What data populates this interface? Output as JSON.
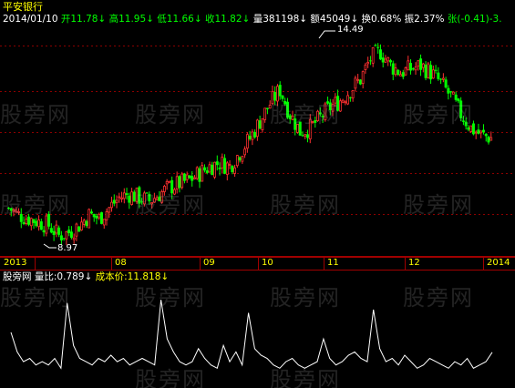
{
  "stock": {
    "name": "平安银行"
  },
  "header": {
    "date": "2014/01/10",
    "open_label": "开",
    "open": "11.78↓",
    "high_label": "高",
    "high": "11.95↓",
    "low_label": "低",
    "low": "11.66↓",
    "close_label": "收",
    "close": "11.82↓",
    "volume_label": "量",
    "volume": "381198↓",
    "amount_label": "额",
    "amount": "45049↓",
    "turnover_label": "换",
    "turnover": "0.68%",
    "amplitude_label": "振",
    "amplitude": "2.37%",
    "change_label": "张",
    "change": "(-0.41)-3."
  },
  "annotations": {
    "max_price": "14.49",
    "min_price": "8.97"
  },
  "x_axis": {
    "labels": [
      "2013",
      "08",
      "09",
      "10",
      "11",
      "12",
      "2014"
    ]
  },
  "indicator": {
    "name": "股旁网",
    "ratio_label": "量比:",
    "ratio_value": "0.789↓",
    "cost_label": "成本价:",
    "cost_value": "11.818↓"
  },
  "watermark": {
    "text": "股旁网"
  },
  "colors": {
    "up": "#ff3030",
    "down": "#00ff00",
    "grid": "#8b0000",
    "text": "#ffff00",
    "background": "#000000"
  },
  "chart_data": [
    {
      "type": "candlestick",
      "title": "平安银行",
      "x": [
        "2013",
        "08",
        "09",
        "10",
        "11",
        "12",
        "2014"
      ],
      "ylim": [
        8.5,
        15.0
      ],
      "series": [
        {
          "values": [
            9.8,
            9.6,
            9.5,
            9.4,
            9.3,
            9.0,
            9.1,
            9.3,
            9.6,
            9.5,
            9.8,
            10.1,
            10.2,
            10.1,
            10.0,
            10.2,
            10.4,
            10.5,
            10.6,
            10.8,
            11.0,
            11.1,
            11.0,
            11.4,
            11.8,
            12.3,
            12.8,
            13.2,
            12.5,
            12.0,
            12.1,
            12.4,
            12.7,
            12.9,
            13.2,
            13.5,
            14.1,
            14.3,
            13.9,
            13.7,
            13.8,
            13.9,
            13.7,
            13.4,
            13.0,
            12.5,
            12.1,
            11.9,
            11.82
          ]
        }
      ],
      "extremes": {
        "max": 14.49,
        "min": 8.97
      }
    },
    {
      "type": "line",
      "title": "股旁网",
      "series": [
        {
          "name": "量比",
          "values": [
            1.4,
            0.8,
            0.5,
            0.6,
            0.4,
            0.5,
            0.4,
            0.6,
            0.3,
            2.3,
            1.0,
            0.6,
            0.5,
            0.4,
            0.6,
            0.5,
            0.7,
            0.5,
            0.6,
            0.4,
            0.5,
            0.6,
            0.5,
            0.4,
            2.4,
            1.2,
            0.8,
            0.5,
            0.4,
            0.5,
            0.9,
            0.6,
            0.4,
            0.3,
            1.0,
            0.5,
            0.8,
            0.4,
            2.0,
            0.9,
            0.7,
            0.6,
            0.4,
            0.3,
            0.5,
            0.6,
            0.4,
            0.3,
            0.4,
            0.5,
            1.2,
            0.6,
            0.4,
            0.5,
            0.7,
            0.8,
            0.6,
            0.5,
            2.1,
            0.9,
            0.5,
            0.6,
            0.4,
            0.7,
            0.5,
            0.3,
            0.4,
            0.6,
            0.5,
            0.4,
            0.3,
            0.5,
            0.4,
            0.6,
            0.3,
            0.4,
            0.5,
            0.789
          ]
        }
      ]
    }
  ]
}
